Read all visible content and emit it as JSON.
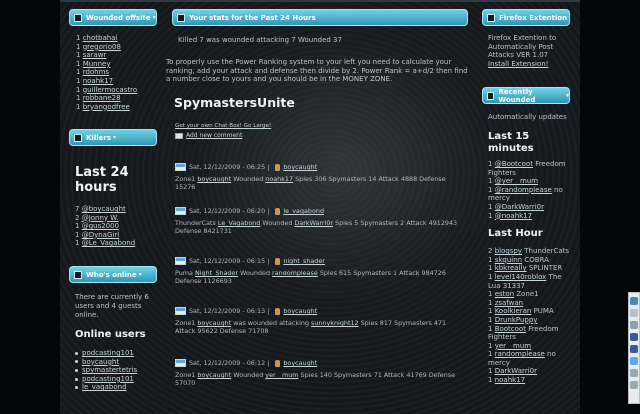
{
  "left": {
    "wounded_title": "Wounded offsite",
    "wounded": [
      {
        "n": "1",
        "name": "chotbahai"
      },
      {
        "n": "1",
        "name": "gregorio08"
      },
      {
        "n": "1",
        "name": "sarawr"
      },
      {
        "n": "1",
        "name": "Munney"
      },
      {
        "n": "1",
        "name": "rdohms"
      },
      {
        "n": "1",
        "name": "noahk17"
      },
      {
        "n": "1",
        "name": "guillermocastro"
      },
      {
        "n": "1",
        "name": "robbane28"
      },
      {
        "n": "1",
        "name": "bryangodfree"
      }
    ],
    "killers_title": "Killers",
    "killers_heading": "Last 24 hours",
    "killers": [
      {
        "n": "7",
        "name": "@boycaught"
      },
      {
        "n": "2",
        "name": "@Jonny W."
      },
      {
        "n": "1",
        "name": "@gus2000"
      },
      {
        "n": "1",
        "name": "@DynaGirl"
      },
      {
        "n": "1",
        "name": "@Le_Vagabond"
      }
    ],
    "online_title": "Who's online",
    "online_text": "There are currently 6 users and 4 guests online.",
    "online_heading": "Online users",
    "online_users": [
      "podcasting101",
      "boycaught",
      "spymastertetris",
      "podcasting101",
      "le_vagabond"
    ]
  },
  "middle": {
    "title": "Your stats for the Past 24 Hours",
    "killed_text": "Killed 7 was wounded attacking 7 Wounded 37",
    "ranking_text": "To properly use the Power Ranking system to your left you need to calculate your ranking, add your attack and defense then divide by 2. Power Rank = a+d/2 then find a number close to yours and you should be in the MONEY ZONE.",
    "heading": "SpymastersUnite",
    "chat_link": "Get your own Chat Box! Go Large!",
    "add_comment": "Add new comment",
    "entries": [
      {
        "date": "Sat, 12/12/2009 - 06:25",
        "user": "boycaught",
        "pre": "Zone1",
        "a": "boycaught",
        "mid": "Wounded",
        "b": "noahk17",
        "post": "Spies 306 Spymasters 14 Attack 4888 Defense 15276"
      },
      {
        "date": "Sat, 12/12/2009 - 06:20",
        "user": "le_vagabond",
        "pre": "ThunderCats",
        "a": "Le_Vagabond",
        "mid": "Wounded",
        "b": "DarkWarri0r",
        "post": "Spies 5 Spymasters 2 Attack 4912943 Defense 8421731"
      },
      {
        "date": "Sat, 12/12/2009 - 06:15",
        "user": "night_shader",
        "pre": "Puma",
        "a": "Night_Shader",
        "mid": "Wounded",
        "b": "randomplease",
        "post": "Spies 615 Spymasters 1 Attack 984726 Defense 1126693"
      },
      {
        "date": "Sat, 12/12/2009 - 06:13",
        "user": "boycaught",
        "pre": "Zone1",
        "a": "boycaught",
        "mid": "was wounded attacking",
        "b": "sunnyknight12",
        "post": "Spies 817 Spymasters 471 Attack 95622 Defense 71708"
      },
      {
        "date": "Sat, 12/12/2009 - 06:12",
        "user": "boycaught",
        "pre": "Zone1",
        "a": "boycaught",
        "mid": "Wounded",
        "b": "yer__mum",
        "post": "Spies 140 Spymasters 71 Attack 41769 Defense 57070"
      }
    ]
  },
  "right": {
    "ext_title": "Firefox Extention",
    "ext_text": "Firefox Extention to Automatically Post Attacks VER 1.07",
    "ext_link": "Install Extension!",
    "rw_title": "Recently Wounded",
    "auto_updates": "Automatically updates",
    "h15": "Last 15 minutes",
    "list15": [
      {
        "n": "1",
        "name": "@Bootcoot",
        "team": "Freedom Fighters"
      },
      {
        "n": "1",
        "name": "@yer__mum",
        "team": ""
      },
      {
        "n": "1",
        "name": "@randomplease",
        "team": "no mercy"
      },
      {
        "n": "1",
        "name": "@DarkWarri0r",
        "team": ""
      },
      {
        "n": "1",
        "name": "@noahk17",
        "team": ""
      }
    ],
    "hhour": "Last Hour",
    "listhour": [
      {
        "n": "2",
        "name": "blogspy",
        "team": "ThunderCats"
      },
      {
        "n": "1",
        "name": "skquinn",
        "team": "COBRA"
      },
      {
        "n": "1",
        "name": "kbkreally",
        "team": "SPLINTER"
      },
      {
        "n": "1",
        "name": "level140roblox",
        "team": "The Lua 31337"
      },
      {
        "n": "1",
        "name": "eston",
        "team": "Zone1"
      },
      {
        "n": "1",
        "name": "zsafwan",
        "team": ""
      },
      {
        "n": "1",
        "name": "Koolkieran",
        "team": "PUMA"
      },
      {
        "n": "1",
        "name": "DrunkPuppy",
        "team": ""
      },
      {
        "n": "1",
        "name": "Bootcoot",
        "team": "Freedom Fighters"
      },
      {
        "n": "1",
        "name": "yer__mum",
        "team": ""
      },
      {
        "n": "1",
        "name": "randomplease",
        "team": "no mercy"
      },
      {
        "n": "1",
        "name": "DarkWarri0r",
        "team": ""
      },
      {
        "n": "1",
        "name": "noahk17",
        "team": ""
      }
    ]
  }
}
